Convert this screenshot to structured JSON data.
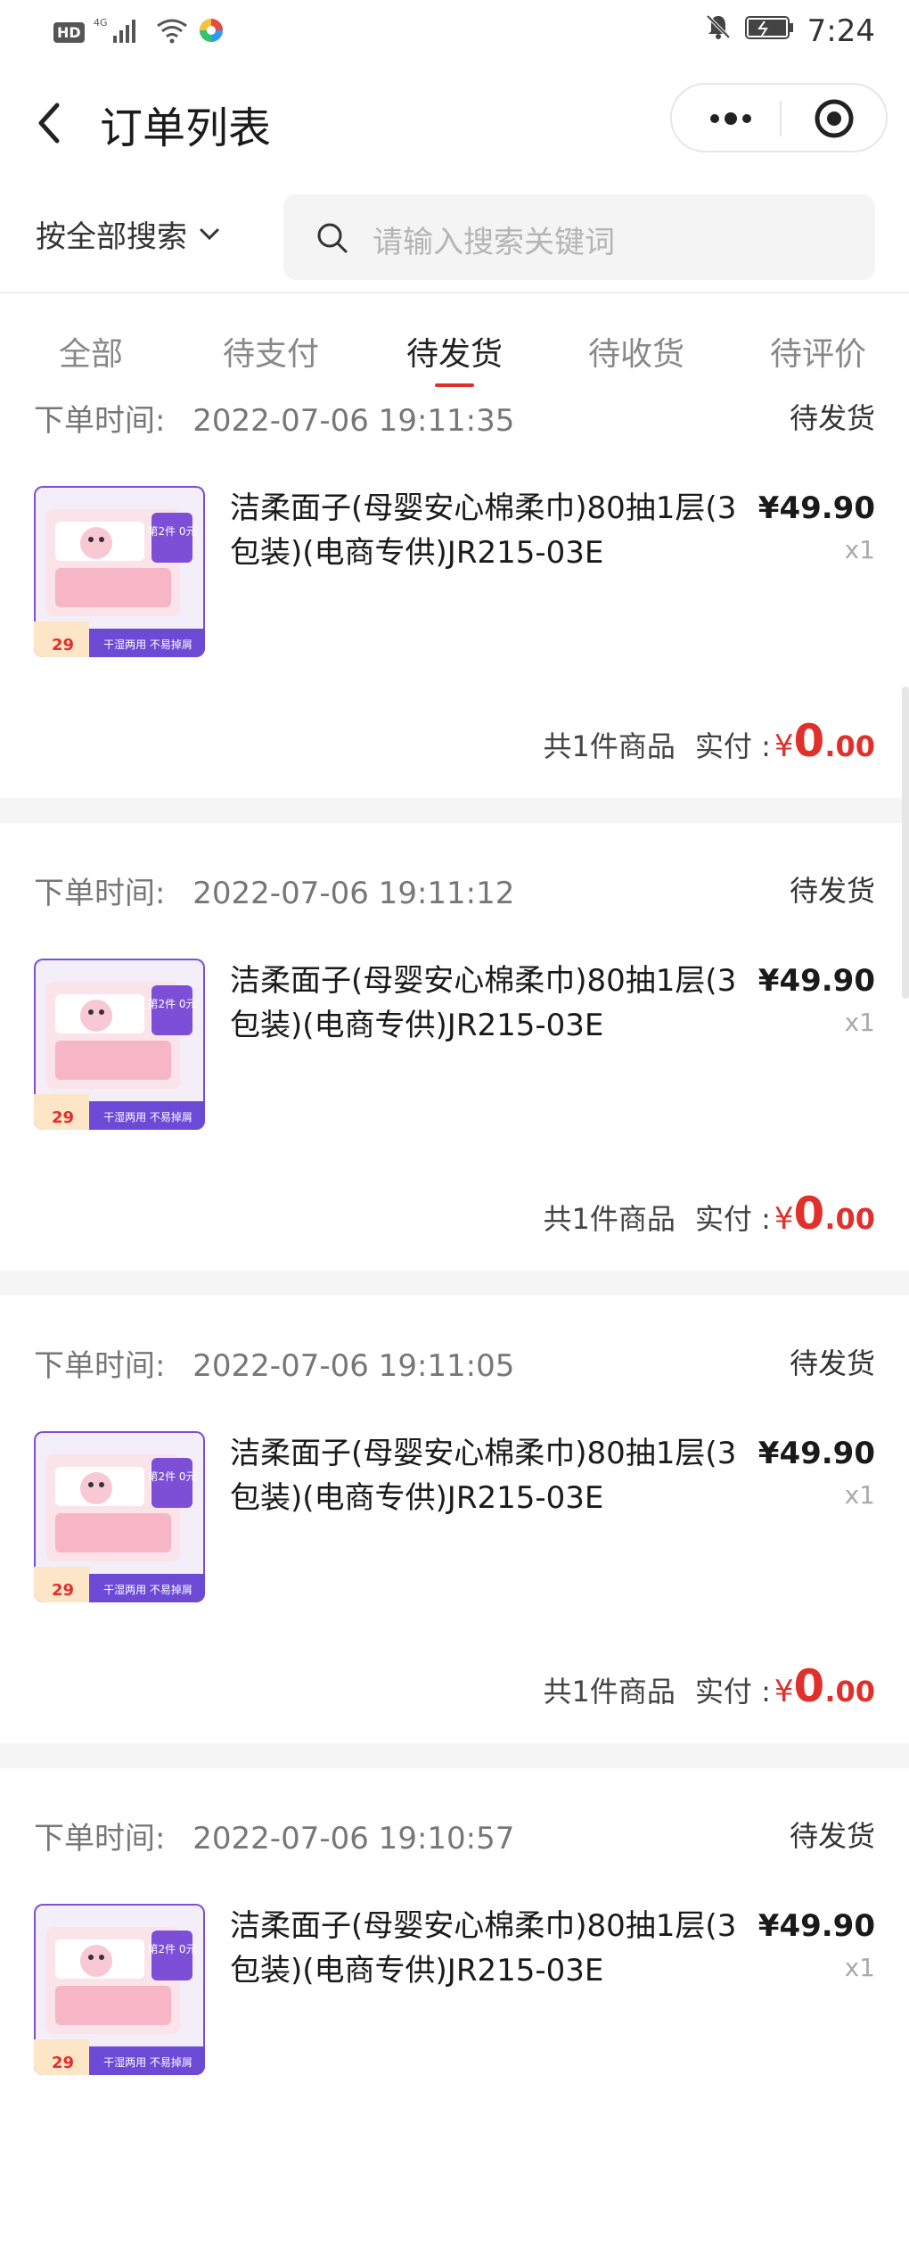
{
  "status_bar": {
    "network": "4G",
    "time": "7:24"
  },
  "header": {
    "title": "订单列表"
  },
  "search": {
    "scope_label": "按全部搜索",
    "placeholder": "请输入搜索关键词"
  },
  "tabs": [
    {
      "label": "全部"
    },
    {
      "label": "待支付"
    },
    {
      "label": "待发货",
      "active": true
    },
    {
      "label": "待收货"
    },
    {
      "label": "待评价"
    }
  ],
  "accent_color": "#e0302c",
  "orders": [
    {
      "time_label": "下单时间:",
      "time": "2022-07-06 19:11:35",
      "status": "待发货",
      "product_name": "洁柔面子(母婴安心棉柔巾)80抽1层(3包装)(电商专供)JR215-03E",
      "price": "¥49.90",
      "qty": "x1",
      "summary": "共1件商品",
      "paid_label": "实付 :",
      "paid_currency": "¥",
      "paid_int": "0",
      "paid_dec": ".00"
    },
    {
      "time_label": "下单时间:",
      "time": "2022-07-06 19:11:12",
      "status": "待发货",
      "product_name": "洁柔面子(母婴安心棉柔巾)80抽1层(3包装)(电商专供)JR215-03E",
      "price": "¥49.90",
      "qty": "x1",
      "summary": "共1件商品",
      "paid_label": "实付 :",
      "paid_currency": "¥",
      "paid_int": "0",
      "paid_dec": ".00"
    },
    {
      "time_label": "下单时间:",
      "time": "2022-07-06 19:11:05",
      "status": "待发货",
      "product_name": "洁柔面子(母婴安心棉柔巾)80抽1层(3包装)(电商专供)JR215-03E",
      "price": "¥49.90",
      "qty": "x1",
      "summary": "共1件商品",
      "paid_label": "实付 :",
      "paid_currency": "¥",
      "paid_int": "0",
      "paid_dec": ".00"
    },
    {
      "time_label": "下单时间:",
      "time": "2022-07-06 19:10:57",
      "status": "待发货",
      "product_name": "洁柔面子(母婴安心棉柔巾)80抽1层(3包装)(电商专供)JR215-03E",
      "price": "¥49.90",
      "qty": "x1",
      "summary": "",
      "paid_label": "",
      "paid_currency": "",
      "paid_int": "",
      "paid_dec": ""
    }
  ],
  "thumb": {
    "badge_top": "第2件 0元",
    "price_tag": "29",
    "bottom_text": "干湿两用 不易掉屑"
  }
}
